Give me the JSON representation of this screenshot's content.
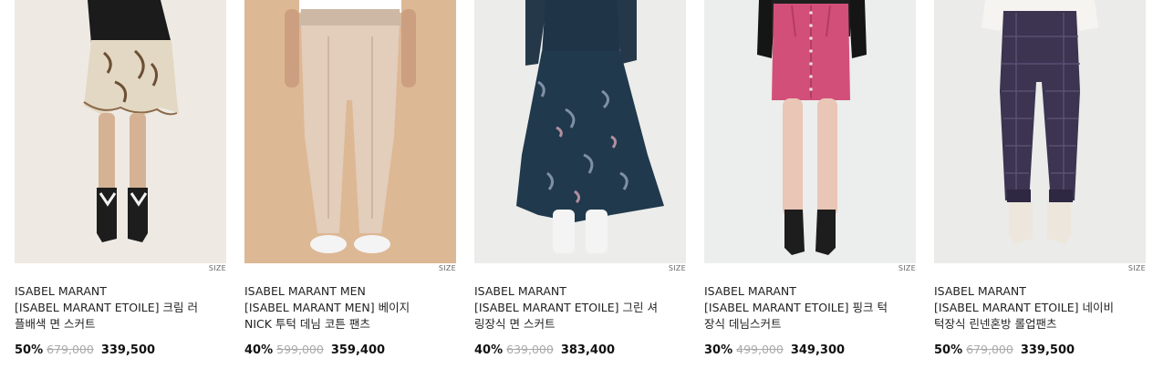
{
  "size_label": "SIZE",
  "products": [
    {
      "brand": "ISABEL MARANT",
      "name": "[ISABEL MARANT ETOILE] 크림 러플배색 면 스커트",
      "discount": "50%",
      "original_price": "679,000",
      "sale_price": "339,500",
      "bg": "#eeeae3"
    },
    {
      "brand": "ISABEL MARANT MEN",
      "name": "[ISABEL MARANT MEN] 베이지 NICK 투턱 데님 코튼 팬츠",
      "discount": "40%",
      "original_price": "599,000",
      "sale_price": "359,400",
      "bg": "#ddb894"
    },
    {
      "brand": "ISABEL MARANT",
      "name": "[ISABEL MARANT ETOILE] 그린 셔링장식 면 스커트",
      "discount": "40%",
      "original_price": "639,000",
      "sale_price": "383,400",
      "bg": "#ececea"
    },
    {
      "brand": "ISABEL MARANT",
      "name": "[ISABEL MARANT ETOILE] 핑크 턱장식 데님스커트",
      "discount": "30%",
      "original_price": "499,000",
      "sale_price": "349,300",
      "bg": "#eceded"
    },
    {
      "brand": "ISABEL MARANT",
      "name": "[ISABEL MARANT ETOILE] 네이비 턱장식 린넨혼방 롤업팬츠",
      "discount": "50%",
      "original_price": "679,000",
      "sale_price": "339,500",
      "bg": "#ebebea"
    }
  ]
}
